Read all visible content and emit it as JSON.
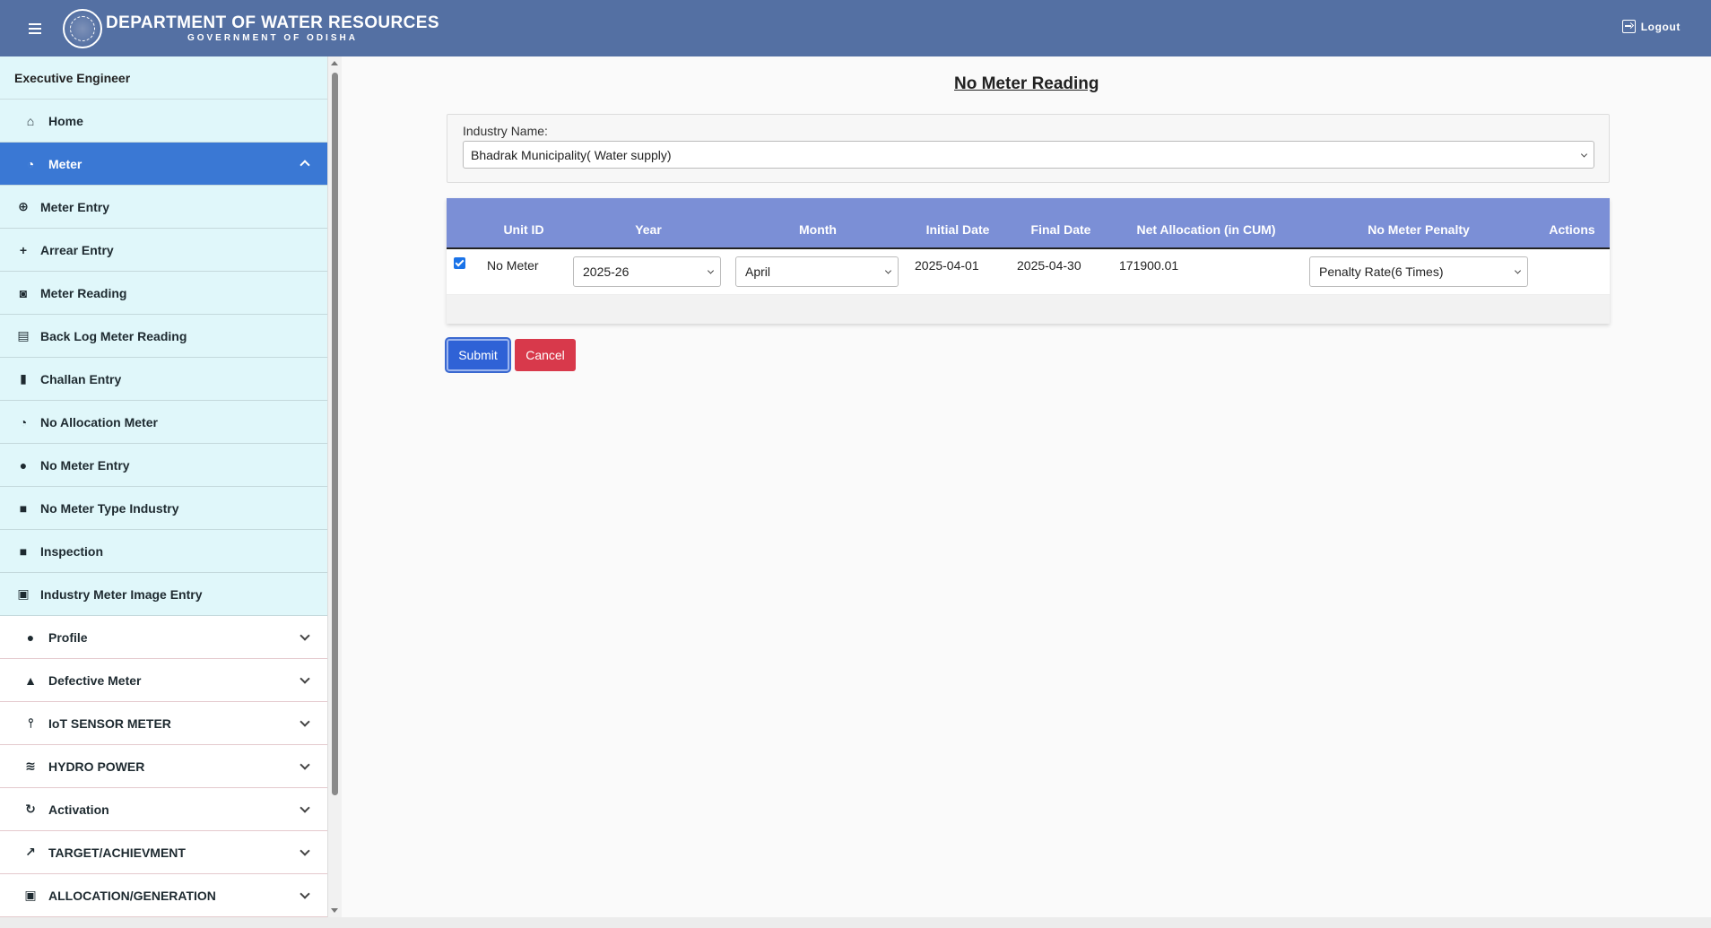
{
  "header": {
    "title": "DEPARTMENT OF WATER RESOURCES",
    "subtitle": "GOVERNMENT OF ODISHA",
    "logout_label": "Logout"
  },
  "sidebar": {
    "role": "Executive Engineer",
    "items": [
      {
        "label": "Home",
        "icon": "home-icon"
      },
      {
        "label": "Meter",
        "icon": "meter-icon",
        "expanded": true
      },
      {
        "label": "Meter Entry",
        "icon": "plus-circle-icon"
      },
      {
        "label": "Arrear Entry",
        "icon": "plus-icon"
      },
      {
        "label": "Meter Reading",
        "icon": "image-search-icon"
      },
      {
        "label": "Back Log Meter Reading",
        "icon": "library-icon"
      },
      {
        "label": "Challan Entry",
        "icon": "document-icon"
      },
      {
        "label": "No Allocation Meter",
        "icon": "meter-icon"
      },
      {
        "label": "No Meter Entry",
        "icon": "alert-circle-icon"
      },
      {
        "label": "No Meter Type Industry",
        "icon": "briefcase-icon"
      },
      {
        "label": "Inspection",
        "icon": "briefcase-icon"
      },
      {
        "label": "Industry Meter Image Entry",
        "icon": "add-photo-icon"
      },
      {
        "label": "Profile",
        "icon": "person-icon"
      },
      {
        "label": "Defective Meter",
        "icon": "warning-icon"
      },
      {
        "label": "IoT SENSOR METER",
        "icon": "sensor-icon"
      },
      {
        "label": "HYDRO POWER",
        "icon": "waves-icon"
      },
      {
        "label": "Activation",
        "icon": "refresh-icon"
      },
      {
        "label": "TARGET/ACHIEVMENT",
        "icon": "trending-icon"
      },
      {
        "label": "ALLOCATION/GENERATION",
        "icon": "search-document-icon"
      }
    ]
  },
  "main": {
    "page_title": "No Meter Reading",
    "industry_label": "Industry Name:",
    "industry_value": "Bhadrak Municipality( Water supply)",
    "table": {
      "headers": [
        "Unit ID",
        "Year",
        "Month",
        "Initial Date",
        "Final Date",
        "Net Allocation (in CUM)",
        "No Meter Penalty",
        "Actions"
      ],
      "row": {
        "checked": true,
        "unit_id": "No Meter",
        "year": "2025-26",
        "month": "April",
        "initial_date": "2025-04-01",
        "final_date": "2025-04-30",
        "net_allocation": "171900.01",
        "penalty": "Penalty Rate(6 Times)"
      }
    },
    "submit_label": "Submit",
    "cancel_label": "Cancel"
  },
  "colors": {
    "header_bg": "#5470a3",
    "active_menu": "#3a78d4",
    "menu_bg": "#e0f7fa",
    "table_header": "#7b8fd6",
    "submit": "#2f62d6",
    "cancel": "#d8394b"
  }
}
